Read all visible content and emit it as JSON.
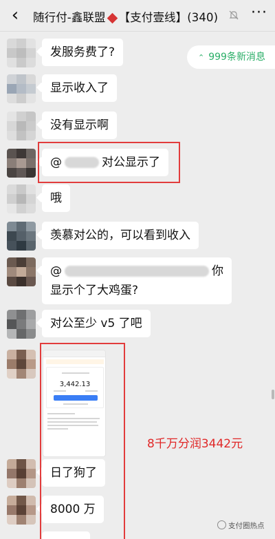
{
  "header": {
    "back_icon": "chevron-left-icon",
    "title_left": "随行付-鑫联盟",
    "title_right": "【支付壹线】(340)",
    "mute_icon": "bell-muted-icon",
    "more_icon": "more-dots-icon"
  },
  "new_messages": {
    "icon": "double-chevron-up-icon",
    "label": "999条新消息"
  },
  "messages": [
    {
      "text": "发服务费了?"
    },
    {
      "text": "显示收入了"
    },
    {
      "text": "没有显示啊"
    },
    {
      "at": "@",
      "text": "对公显示了"
    },
    {
      "text": "哦"
    },
    {
      "text": "羡慕对公的，可以看到收入"
    },
    {
      "at": "@",
      "line1_end": "你",
      "line2": "显示个了大鸡蛋?"
    },
    {
      "text": "对公至少 v5 了吧"
    },
    {
      "text": "日了狗了"
    },
    {
      "text": "8000 万"
    }
  ],
  "screenshot": {
    "amount": "3,442.13"
  },
  "annotation": "8千万分润3442元",
  "watermark": "支付圈热点",
  "colors": {
    "accent_green": "#2aae67",
    "annotation_red": "#e02828",
    "bg": "#ededed"
  }
}
